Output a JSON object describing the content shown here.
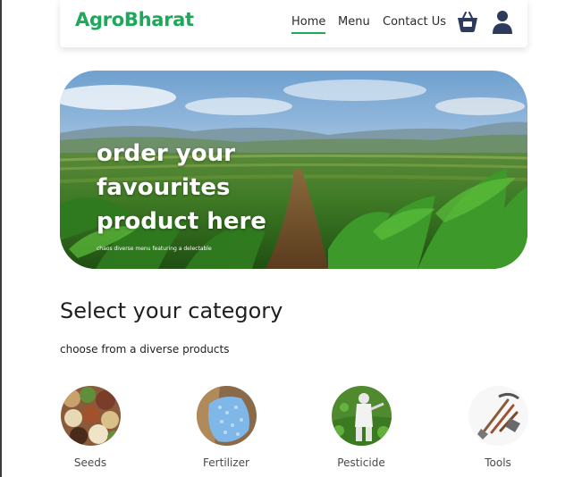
{
  "brand": {
    "name": "AgroBharat",
    "color": "#1ea85a"
  },
  "nav": {
    "links": [
      "Home",
      "Menu",
      "Contact Us"
    ],
    "active": "Home",
    "icons": [
      "shopping-basket-icon",
      "user-icon"
    ]
  },
  "hero": {
    "title": "order your favourites product here",
    "subtitle": "chaos diverse menu featuring a delectable"
  },
  "section": {
    "title": "Select your category",
    "subtitle": "choose from a diverse products"
  },
  "categories": [
    {
      "label": "Seeds"
    },
    {
      "label": "Fertilizer"
    },
    {
      "label": "Pesticide"
    },
    {
      "label": "Tools"
    }
  ]
}
